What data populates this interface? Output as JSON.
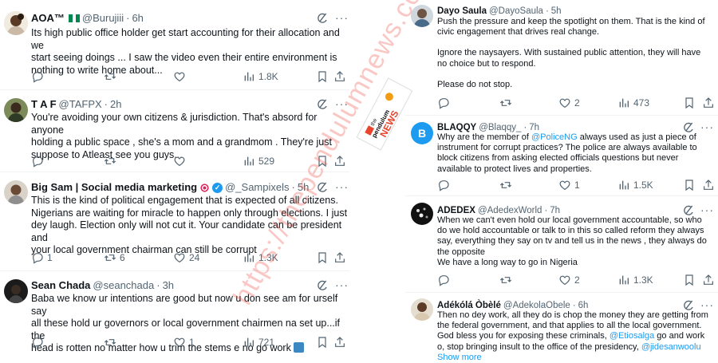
{
  "watermark": "https://thependulumnews.com/",
  "logo": {
    "line1": "the",
    "line2": "pendulum",
    "line3": "NEWS"
  },
  "left": [
    {
      "name": "AOA™",
      "handle": "@Burujiii",
      "time": "6h",
      "lines": [
        "Its high public office holder get start  accounting for their allocation and we",
        "start seeing doings ... I saw the video even their entire environment is",
        "nothing to write home about..."
      ],
      "stats": {
        "replies": "",
        "reposts": "",
        "likes": "",
        "views": "1.8K"
      }
    },
    {
      "name": "T A F",
      "handle": "@TAFPX",
      "time": "2h",
      "lines": [
        "You're avoiding  your own citizens & jurisdiction. That's absord for anyone",
        "holding a public space , she's a mom and a grandmom . They're just",
        "suppose to Atleast see you guys..."
      ],
      "stats": {
        "replies": "",
        "reposts": "",
        "likes": "",
        "views": "529"
      }
    },
    {
      "name": "Big Sam | Social media marketing",
      "handle": "@_Sampixels",
      "time": "5h",
      "lines": [
        "This is the kind of political engagement that is expected of all citizens.",
        "Nigerians are waiting for miracle to happen only through elections. I just",
        "dey laugh. Election only will not cut it.  Your candidate can be president and",
        "your local government chairman can still be corrupt"
      ],
      "stats": {
        "replies": "1",
        "reposts": "6",
        "likes": "24",
        "views": "1.3K"
      }
    },
    {
      "name": "Sean Chada",
      "handle": "@seanchada",
      "time": "3h",
      "lines": [
        "Baba we know ur intentions are good but now u don see am for urself say",
        "all these hold ur governors or local government chairmen na set up...if the",
        "head is rotten no matter how u trim the stems e no go work"
      ],
      "stats": {
        "replies": "",
        "reposts": "",
        "likes": "1",
        "views": "721"
      }
    }
  ],
  "right": [
    {
      "name": "Dayo Saula",
      "handle": "@DayoSaula",
      "time": "5h",
      "paragraphs": [
        "Push the pressure and keep the spotlight on them. That is the kind of civic engagement that drives real change.",
        "Ignore the naysayers. With sustained public attention, they will have no choice but to respond.",
        "Please do not stop."
      ],
      "stats": {
        "replies": "",
        "reposts": "",
        "likes": "2",
        "views": "473"
      }
    },
    {
      "name": "BLAQQY",
      "handle": "@Blaqqy_",
      "time": "7h",
      "avatar_letter": "B",
      "before": "Why are the member of ",
      "mention": "@PoliceNG",
      "after": " always used as just a piece of instrument for corrupt practices? The police are always available to block citizens from asking elected officials questions but never available to protect lives and properties.",
      "stats": {
        "replies": "",
        "reposts": "",
        "likes": "1",
        "views": "1.5K"
      }
    },
    {
      "name": "ADEDEX",
      "handle": "@AdedexWorld",
      "time": "7h",
      "paragraphs": [
        "When we can't even hold our local government accountable, so who do we hold accountable or talk to in this so called reform they always say, everything they say on tv and tell us in the news , they always do the opposite",
        "We have a long way to go in Nigeria"
      ],
      "stats": {
        "replies": "",
        "reposts": "",
        "likes": "2",
        "views": "1.3K"
      }
    },
    {
      "name": "Adékólá Òbèlé",
      "handle": "@AdekolaObele",
      "time": "6h",
      "t1": "Then no dey work, all they do is chop the money they are getting from the federal government, and that applies to all the local government. God bless you for exposing these criminals, ",
      "m1": "@Etiosalga",
      "t2": " go and work o, stop bringing insult to the office of the presidency, ",
      "m2": "@jidesanwoolu",
      "show_more": "Show more"
    }
  ]
}
